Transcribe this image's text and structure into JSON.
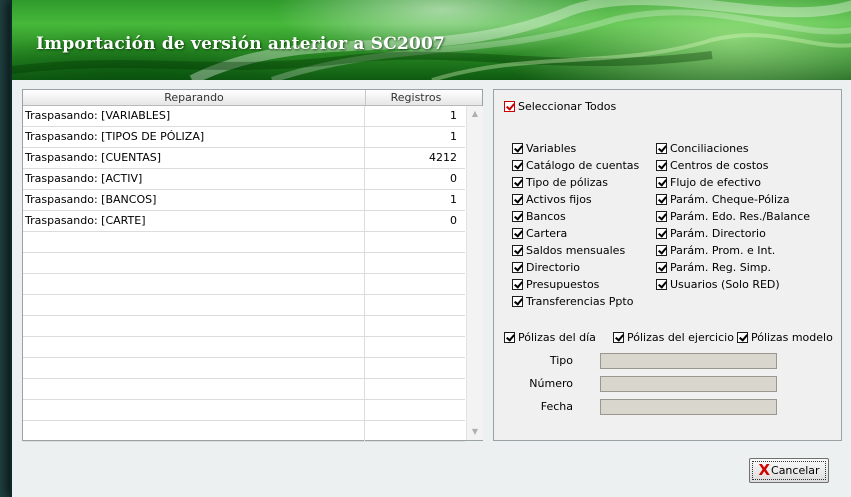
{
  "window": {
    "title": "Importación de versión anterior a SC2007"
  },
  "grid": {
    "columns": [
      "Reparando",
      "Registros"
    ],
    "rows": [
      {
        "name": "Traspasando: [VARIABLES]",
        "count": "1"
      },
      {
        "name": "Traspasando: [TIPOS DE PÓLIZA]",
        "count": "1"
      },
      {
        "name": "Traspasando: [CUENTAS]",
        "count": "4212"
      },
      {
        "name": "Traspasando: [ACTIV]",
        "count": "0"
      },
      {
        "name": "Traspasando: [BANCOS]",
        "count": "1"
      },
      {
        "name": "Traspasando: [CARTE]",
        "count": "0"
      },
      {
        "name": "",
        "count": ""
      },
      {
        "name": "",
        "count": ""
      },
      {
        "name": "",
        "count": ""
      },
      {
        "name": "",
        "count": ""
      },
      {
        "name": "",
        "count": ""
      },
      {
        "name": "",
        "count": ""
      },
      {
        "name": "",
        "count": ""
      },
      {
        "name": "",
        "count": ""
      },
      {
        "name": "",
        "count": ""
      },
      {
        "name": "",
        "count": ""
      }
    ]
  },
  "options": {
    "select_all": "Seleccionar Todos",
    "left": [
      "Variables",
      "Catálogo de cuentas",
      "Tipo de pólizas",
      "Activos fijos",
      "Bancos",
      "Cartera",
      "Saldos mensuales",
      "Directorio",
      "Presupuestos",
      "Transferencias Ppto"
    ],
    "right": [
      "Conciliaciones",
      "Centros de costos",
      "Flujo de efectivo",
      "Parám. Cheque-Póliza",
      "Parám. Edo. Res./Balance",
      "Parám. Directorio",
      "Parám. Prom. e Int.",
      "Parám. Reg. Simp.",
      "Usuarios (Solo RED)"
    ],
    "polizas": [
      "Pólizas del día",
      "Pólizas del ejercicio",
      "Pólizas modelo"
    ]
  },
  "form": {
    "tipo_label": "Tipo",
    "tipo_value": "",
    "numero_label": "Número",
    "numero_value": "",
    "fecha_label": "Fecha",
    "fecha_value": ""
  },
  "buttons": {
    "cancel_x": "X",
    "cancel_label": "Cancelar"
  },
  "colors": {
    "banner_green": "#2f9a2b",
    "checkbox_red": "#cc0000",
    "cancel_x": "#d00000"
  }
}
